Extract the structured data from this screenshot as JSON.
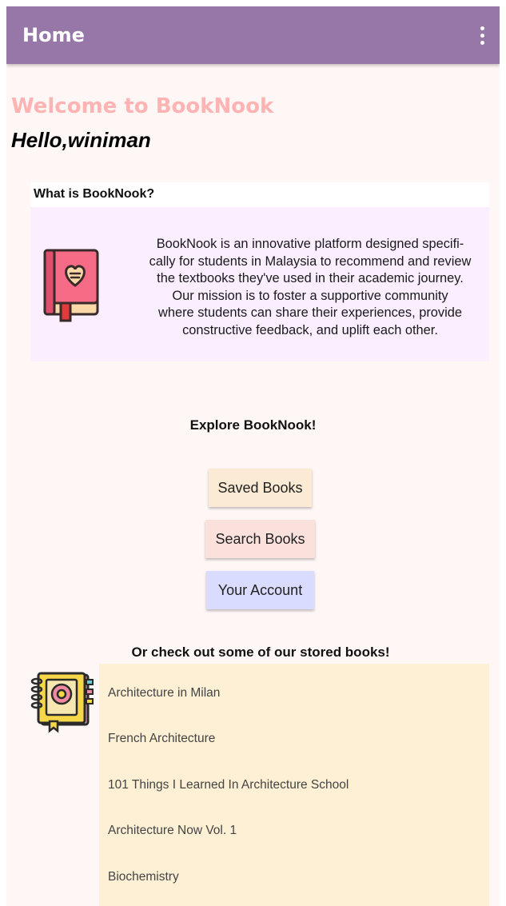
{
  "appbar": {
    "title": "Home",
    "overflow_icon": "more-vert-icon"
  },
  "welcome_title": "Welcome to BookNook",
  "greeting": "Hello,winiman",
  "about": {
    "heading": "What is BookNook?",
    "lines": [
      "BookNook is an innovative platform designed specifi-",
      "cally for students in Malaysia to recommend and review",
      "the textbooks they've used in their academic journey.",
      "Our mission is to foster a supportive community",
      "where students can share their experiences, provide",
      "constructive feedback, and uplift each other."
    ],
    "icon": "heart-book-icon"
  },
  "explore": {
    "heading": "Explore BookNook!",
    "buttons": {
      "saved": "Saved Books",
      "search": "Search Books",
      "account": "Your Account"
    }
  },
  "stored": {
    "heading": "Or check out some of our stored books!",
    "icon": "flower-notebook-icon",
    "books": [
      "Architecture in Milan",
      "French Architecture",
      "101 Things I Learned In Architecture School",
      "Architecture Now Vol. 1",
      "Biochemistry"
    ]
  },
  "colors": {
    "appbar": "#9777a8",
    "background": "#fff7f6",
    "welcome": "#ffb3b3",
    "about_body": "#fbeeff",
    "btn_saved": "#fcebd4",
    "btn_search": "#fbe1dc",
    "btn_account": "#d9dcff",
    "book_list": "#fdf0d4"
  }
}
